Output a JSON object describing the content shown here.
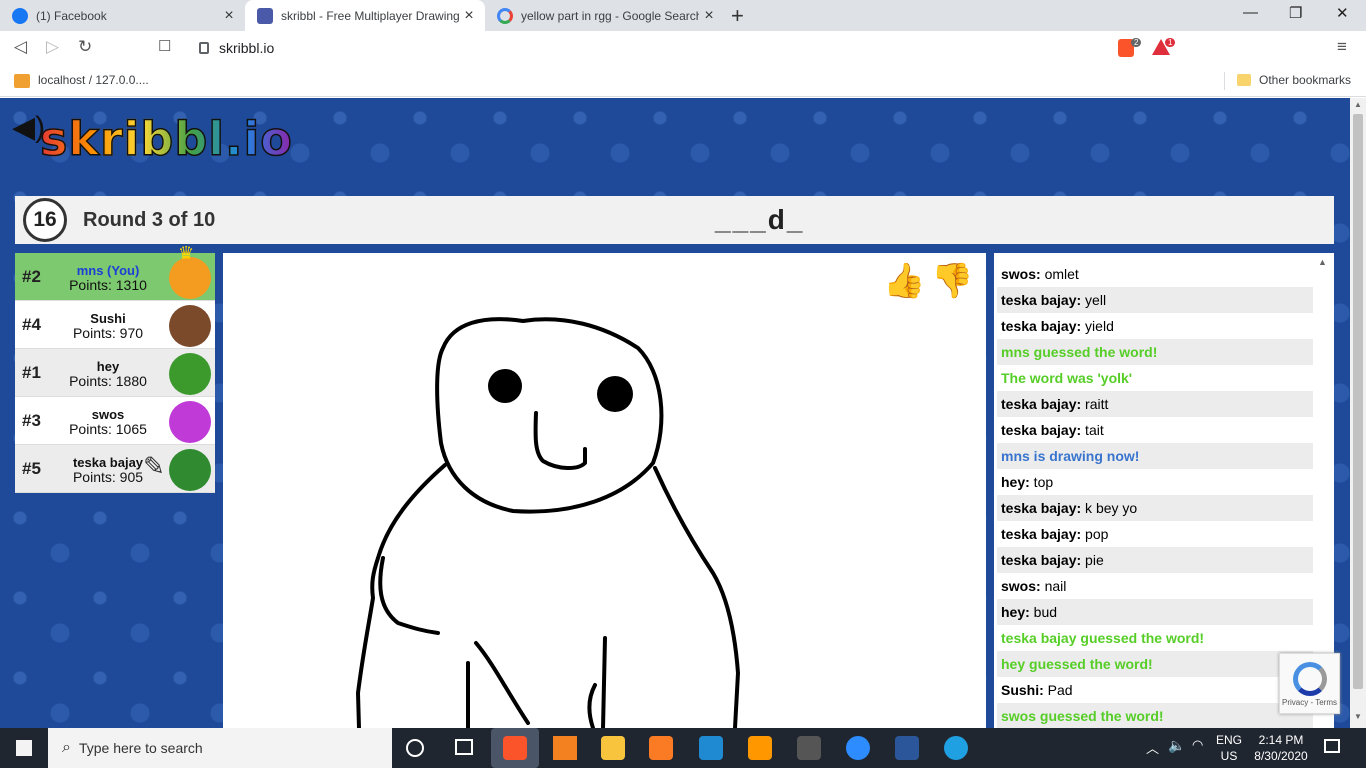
{
  "tabs": [
    {
      "title": "(1) Facebook",
      "close": "×"
    },
    {
      "title": "skribbl - Free Multiplayer Drawing",
      "close": "×"
    },
    {
      "title": "yellow part in rgg - Google Search",
      "close": "×"
    }
  ],
  "new_tab": "+",
  "window": {
    "minimize": "—",
    "maximize": "❐",
    "close": "✕"
  },
  "address": {
    "url": "skribbl.io"
  },
  "extension_badges": {
    "brave": "2",
    "rewards": "1"
  },
  "bookmarks": {
    "left": "localhost / 127.0.0....",
    "right": "Other bookmarks"
  },
  "game": {
    "logo": "skribbl.io",
    "timer": "16",
    "round": "Round 3 of 10",
    "word_hint": "___d_",
    "players": [
      {
        "rank": "#2",
        "name": "mns (You)",
        "points": "Points: 1310",
        "avatar_color": "#f39c1f"
      },
      {
        "rank": "#4",
        "name": "Sushi",
        "points": "Points: 970",
        "avatar_color": "#7a4a2a"
      },
      {
        "rank": "#1",
        "name": "hey",
        "points": "Points: 1880",
        "avatar_color": "#3c9a2d"
      },
      {
        "rank": "#3",
        "name": "swos",
        "points": "Points: 1065",
        "avatar_color": "#c03ad8"
      },
      {
        "rank": "#5",
        "name": "teska bajay",
        "points": "Points: 905",
        "avatar_color": "#2f8a30"
      }
    ],
    "chat": [
      {
        "user": "swos:",
        "text": " omlet",
        "type": "normal"
      },
      {
        "user": "teska bajay:",
        "text": " yell",
        "type": "normal"
      },
      {
        "user": "teska bajay:",
        "text": " yield",
        "type": "normal"
      },
      {
        "user": "",
        "text": "mns guessed the word!",
        "type": "green"
      },
      {
        "user": "",
        "text": "The word was 'yolk'",
        "type": "green"
      },
      {
        "user": "teska bajay:",
        "text": " raitt",
        "type": "normal"
      },
      {
        "user": "teska bajay:",
        "text": " tait",
        "type": "normal"
      },
      {
        "user": "",
        "text": "mns is drawing now!",
        "type": "blue"
      },
      {
        "user": "hey:",
        "text": " top",
        "type": "normal"
      },
      {
        "user": "teska bajay:",
        "text": " k bey yo",
        "type": "normal"
      },
      {
        "user": "teska bajay:",
        "text": " pop",
        "type": "normal"
      },
      {
        "user": "teska bajay:",
        "text": " pie",
        "type": "normal"
      },
      {
        "user": "swos:",
        "text": " nail",
        "type": "normal"
      },
      {
        "user": "hey:",
        "text": " bud",
        "type": "normal"
      },
      {
        "user": "",
        "text": "teska bajay guessed the word!",
        "type": "green"
      },
      {
        "user": "",
        "text": "hey guessed the word!",
        "type": "green"
      },
      {
        "user": "Sushi:",
        "text": " Pad",
        "type": "normal"
      },
      {
        "user": "",
        "text": "swos guessed the word!",
        "type": "green"
      }
    ],
    "recaptcha": "Privacy - Terms"
  },
  "taskbar": {
    "search_placeholder": "Type here to search",
    "lang_top": "ENG",
    "lang_bottom": "US",
    "time": "2:14 PM",
    "date": "8/30/2020"
  }
}
